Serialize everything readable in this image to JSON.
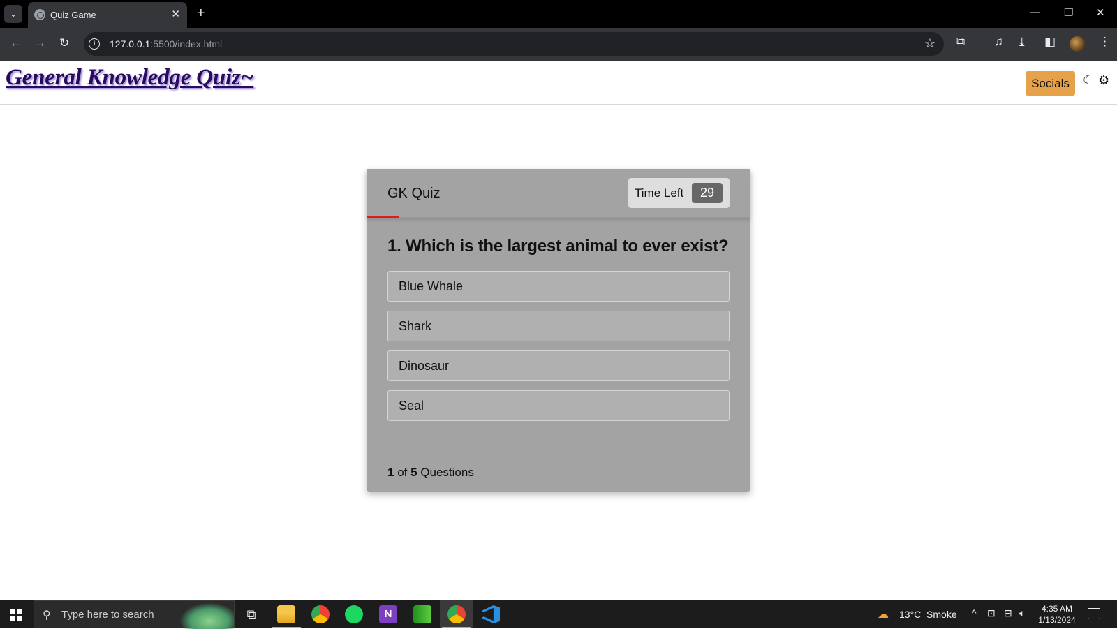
{
  "browser": {
    "tab_title": "Quiz Game",
    "url_host": "127.0.0.1",
    "url_path": ":5500/index.html"
  },
  "site": {
    "title": "General Knowledge Quiz~",
    "socials_label": "Socials"
  },
  "quiz": {
    "title": "GK Quiz",
    "timer_label": "Time Left",
    "timer_value": "29",
    "timer_progress": 0.085,
    "question": "1. Which is the largest animal to ever exist?",
    "options": [
      "Blue Whale",
      "Shark",
      "Dinosaur",
      "Seal"
    ],
    "counter_current": "1",
    "counter_of": " of ",
    "counter_total": "5",
    "counter_suffix": " Questions"
  },
  "taskbar": {
    "search_placeholder": "Type here to search",
    "weather": "13°C  Smoke",
    "time": "4:35 AM",
    "date": "1/13/2024"
  },
  "colors": {
    "accent_socials": "#e5a24b",
    "card_bg": "#a3a3a3",
    "timer_line": "#e01b1b"
  }
}
